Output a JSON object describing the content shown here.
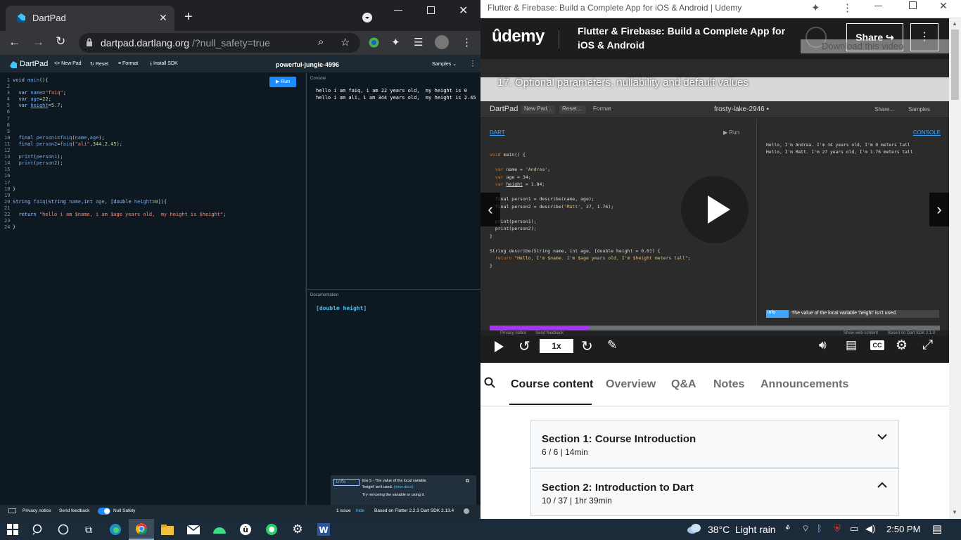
{
  "left_window": {
    "tab_title": "DartPad",
    "url_domain": "dartpad.dartlang.org",
    "url_path": "/?null_safety=true",
    "dartpad": {
      "brand": "DartPad",
      "new_pad": "New Pad",
      "reset": "Reset",
      "format": "Format",
      "install_sdk": "Install SDK",
      "pad_name": "powerful-jungle-4996",
      "samples": "Samples",
      "run": "Run",
      "console_label": "Console",
      "console_lines": [
        "hello i am faiq, i am 22 years old,  my height is 0",
        "hello i am ali, i am 344 years old,  my height is 2.45"
      ],
      "docs_label": "Documentation",
      "docs_text": "[double height]",
      "tooltip": {
        "badge": "info",
        "line1": "line 5 - The value of the local variable",
        "line2": "'height' isn't used.",
        "link": "(view docs)",
        "line3": "Try removing the variable or using it."
      },
      "footer": {
        "privacy": "Privacy notice",
        "feedback": "Send feedback",
        "null_safety": "Null Safety",
        "issues": "1 issue",
        "hide": "hide",
        "based_on": "Based on Flutter 2.2.3 Dart SDK 2.13.4"
      }
    }
  },
  "right_window": {
    "window_title": "Flutter & Firebase: Build a Complete App for iOS & Android | Udemy",
    "logo": "ûdemy",
    "course_title_1": "Flutter & Firebase: Build a Complete App for",
    "course_title_2": "iOS & Android",
    "share": "Share",
    "download": "Download this video",
    "lecture_title": "17. Optional parameters, nullability and default values",
    "video": {
      "brand": "DartPad",
      "new_pad": "New Pad...",
      "reset": "Reset...",
      "format": "Format",
      "pad_name": "frosty-lake-2946 •",
      "share": "Share...",
      "samples": "Samples",
      "dart_label": "DART",
      "run": "Run",
      "console_label": "CONSOLE",
      "console_lines": [
        "Hello, I'm Andrea. I'm 34 years old, I'm 0 meters tall",
        "Hello, I'm Matt. I'm 27 years old, I'm 1.76 meters tall"
      ],
      "info_badge": "info",
      "info_text": "The value of the local variable 'height' isn't used.",
      "privacy": "Privacy notice",
      "feedback": "Send feedback",
      "show_web": "Show web content",
      "based_on": "Based on Dart SDK 2.1.0",
      "speed": "1x",
      "progress": 0.22
    },
    "tabs": [
      "Course content",
      "Overview",
      "Q&A",
      "Notes",
      "Announcements"
    ],
    "sections": [
      {
        "title": "Section 1: Course Introduction",
        "meta": "6 / 6 | 14min"
      },
      {
        "title": "Section 2: Introduction to Dart",
        "meta": "10 / 37 | 1hr 39min"
      }
    ]
  },
  "taskbar": {
    "temperature": "38°C",
    "weather": "Light rain",
    "time": "2:50 PM"
  },
  "colors": {
    "dartpad_bg": "#0e1821",
    "run_button": "#1b8cff",
    "udemy_dark": "#1c1d1f",
    "progress": "#a435f0"
  }
}
